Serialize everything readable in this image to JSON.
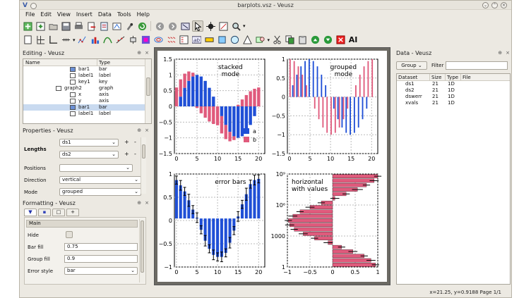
{
  "window": {
    "title": "barplots.vsz - Veusz"
  },
  "menu": [
    "File",
    "Edit",
    "View",
    "Insert",
    "Data",
    "Tools",
    "Help"
  ],
  "editing": {
    "title": "Editing - Veusz",
    "columns": [
      "Name",
      "Type"
    ],
    "rows": [
      {
        "name": "bar1",
        "type": "bar",
        "icon": "bar-icon",
        "indent": 1
      },
      {
        "name": "label1",
        "type": "label",
        "icon": "label-icon",
        "indent": 1
      },
      {
        "name": "key1",
        "type": "key",
        "icon": "key-icon",
        "indent": 1
      },
      {
        "name": "graph2",
        "type": "graph",
        "icon": "graph-icon",
        "indent": 0
      },
      {
        "name": "x",
        "type": "axis",
        "icon": "axis-icon",
        "indent": 1
      },
      {
        "name": "y",
        "type": "axis",
        "icon": "axis-icon",
        "indent": 1
      },
      {
        "name": "bar1",
        "type": "bar",
        "icon": "bar-icon",
        "indent": 1,
        "selected": true
      },
      {
        "name": "label1",
        "type": "label",
        "icon": "label-icon",
        "indent": 1
      }
    ]
  },
  "properties": {
    "title": "Properties - Veusz",
    "lengths_label": "Lengths",
    "lengths": [
      "ds1",
      "ds2"
    ],
    "positions_label": "Positions",
    "positions_value": "",
    "direction_label": "Direction",
    "direction_value": "vertical",
    "mode_label": "Mode",
    "mode_value": "grouped",
    "plus": "+",
    "minus": "-"
  },
  "formatting": {
    "title": "Formatting - Veusz",
    "section": "Main",
    "hide_label": "Hide",
    "barfill_label": "Bar fill",
    "barfill_value": "0.75",
    "groupfill_label": "Group fill",
    "groupfill_value": "0.9",
    "errorstyle_label": "Error style",
    "errorstyle_value": "bar"
  },
  "data": {
    "title": "Data - Veusz",
    "group_button": "Group",
    "filter_label": "Filter",
    "columns": [
      "Dataset",
      "Size",
      "Type",
      "File"
    ],
    "rows": [
      {
        "name": "ds1",
        "size": "21",
        "type": "1D"
      },
      {
        "name": "ds2",
        "size": "21",
        "type": "1D"
      },
      {
        "name": "dswerr",
        "size": "21",
        "type": "1D"
      },
      {
        "name": "xvals",
        "size": "21",
        "type": "1D"
      }
    ]
  },
  "status": "x=21.25, y=0.9188  Page 1/1",
  "colors": {
    "blue": "#1f4fd6",
    "pink": "#e05a7c",
    "highlight": "#c9daf0"
  },
  "chart_data": [
    {
      "type": "bar",
      "label": "stacked\nmode",
      "mode": "stacked",
      "xlim": [
        0,
        22
      ],
      "ylim": [
        -1.5,
        1.5
      ],
      "xticks": [
        "0",
        "5",
        "10",
        "15",
        "20"
      ],
      "yticks": [
        "1.5",
        "1",
        "0.5",
        "0",
        "−0.5",
        "−1",
        "−1.5"
      ],
      "legend": [
        {
          "name": "a",
          "color": "blue"
        },
        {
          "name": "b",
          "color": "pink"
        }
      ],
      "series": [
        {
          "name": "a",
          "values": [
            0,
            0.31,
            0.59,
            0.81,
            0.95,
            1,
            0.95,
            0.81,
            0.59,
            0.31,
            0,
            -0.31,
            -0.59,
            -0.81,
            -0.95,
            -1,
            -0.95,
            -0.81,
            -0.59,
            -0.31,
            0
          ]
        },
        {
          "name": "b",
          "values": [
            0.6,
            0.55,
            0.45,
            0.3,
            0.12,
            -0.05,
            -0.22,
            -0.36,
            -0.48,
            -0.56,
            -0.6,
            -0.55,
            -0.45,
            -0.3,
            -0.12,
            0.05,
            0.22,
            0.36,
            0.48,
            0.56,
            0.6
          ]
        }
      ]
    },
    {
      "type": "bar",
      "label": "grouped\nmode",
      "mode": "grouped",
      "xlim": [
        0,
        22
      ],
      "ylim": [
        -1.5,
        1
      ],
      "xticks": [
        "0",
        "5",
        "10",
        "15",
        "20"
      ],
      "yticks": [
        "1",
        "0.5",
        "0",
        "−0.5",
        "−1",
        "−1.5"
      ],
      "series": [
        {
          "name": "a",
          "values": [
            0,
            0.31,
            0.59,
            0.81,
            0.95,
            1,
            0.95,
            0.81,
            0.59,
            0.31,
            0,
            -0.31,
            -0.59,
            -0.81,
            -0.95,
            -1,
            -0.95,
            -0.81,
            -0.59,
            -0.31,
            0
          ]
        },
        {
          "name": "b",
          "values": [
            1,
            0.95,
            0.81,
            0.59,
            0.31,
            0,
            -0.31,
            -0.59,
            -0.81,
            -0.95,
            -1,
            -0.95,
            -0.81,
            -0.59,
            -0.31,
            0,
            0.31,
            0.59,
            0.81,
            0.95,
            1
          ]
        }
      ]
    },
    {
      "type": "bar",
      "label": "error bars",
      "xlim": [
        0,
        22
      ],
      "ylim": [
        -1.2,
        1.1
      ],
      "xticks": [
        "0",
        "5",
        "10",
        "15",
        "20"
      ],
      "yticks": [
        "1",
        "0.5",
        "0",
        "−0.5",
        "−1"
      ],
      "series": [
        {
          "name": "a",
          "values": [
            0.95,
            0.82,
            0.67,
            0.45,
            0.22,
            0.02,
            -0.28,
            -0.55,
            -0.75,
            -0.9,
            -0.95,
            -0.95,
            -0.85,
            -0.6,
            -0.3,
            0.05,
            0.35,
            0.6,
            0.85,
            0.95,
            0.98
          ],
          "errors": [
            0.1,
            0.12,
            0.1,
            0.15,
            0.1,
            0.12,
            0.1,
            0.13,
            0.1,
            0.12,
            0.1,
            0.12,
            0.1,
            0.13,
            0.1,
            0.12,
            0.1,
            0.15,
            0.1,
            0.12,
            0.1
          ]
        }
      ]
    },
    {
      "type": "bar",
      "label": "horizontal\nwith values",
      "orientation": "horizontal",
      "xlim": [
        -1,
        1
      ],
      "ylog": true,
      "xticks": [
        "−1",
        "−0.5",
        "0",
        "0.5",
        "1"
      ],
      "yticks": [
        "10⁹",
        "10⁶",
        "1000",
        "1"
      ],
      "series": [
        {
          "name": "b",
          "values": [
            1,
            0.92,
            0.75,
            0.55,
            0.3,
            0.05,
            -0.25,
            -0.5,
            -0.72,
            -0.88,
            -0.98,
            -0.95,
            -0.85,
            -0.65,
            -0.4,
            -0.1,
            0.2,
            0.45,
            0.7,
            0.85,
            0.95
          ],
          "errors": [
            0.08,
            0.1,
            0.08,
            0.12,
            0.08,
            0.1,
            0.08,
            0.1,
            0.08,
            0.1,
            0.08,
            0.1,
            0.08,
            0.1,
            0.08,
            0.1,
            0.08,
            0.1,
            0.08,
            0.1,
            0.08
          ]
        }
      ]
    }
  ]
}
